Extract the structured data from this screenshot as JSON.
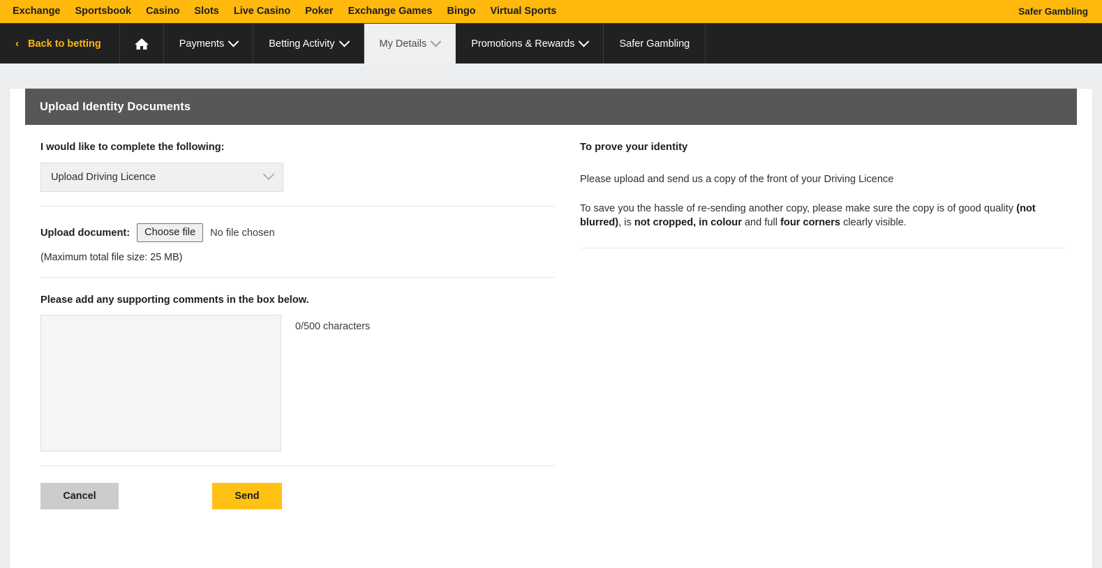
{
  "topbar": {
    "links": [
      {
        "label": "Exchange"
      },
      {
        "label": "Sportsbook"
      },
      {
        "label": "Casino"
      },
      {
        "label": "Slots"
      },
      {
        "label": "Live Casino"
      },
      {
        "label": "Poker"
      },
      {
        "label": "Exchange Games"
      },
      {
        "label": "Bingo"
      },
      {
        "label": "Virtual Sports"
      }
    ],
    "right_label": "Safer Gambling",
    "background": "#ffb80c"
  },
  "navbar": {
    "background": "#212121",
    "back_chevron": "‹",
    "back_label": "Back to betting",
    "home_icon": "home-icon",
    "items": [
      {
        "label": "Payments",
        "has_caret": true,
        "active": false
      },
      {
        "label": "Betting Activity",
        "has_caret": true,
        "active": false
      },
      {
        "label": "My Details",
        "has_caret": true,
        "active": true
      },
      {
        "label": "Promotions & Rewards",
        "has_caret": true,
        "active": false
      },
      {
        "label": "Safer Gambling",
        "has_caret": false,
        "active": false
      }
    ]
  },
  "card": {
    "header_title": "Upload Identity Documents",
    "header_background": "#575757"
  },
  "form": {
    "select_label": "I would like to complete the following:",
    "select_value": "Upload Driving Licence",
    "upload_label": "Upload document:",
    "choose_file_label": "Choose file",
    "no_file_text": "No file chosen",
    "file_size_hint": "(Maximum total file size: 25 MB)",
    "comments_label": "Please add any supporting comments in the box below.",
    "comments_value": "",
    "comments_placeholder": "",
    "char_count": "0/500 characters",
    "cancel_label": "Cancel",
    "send_label": "Send",
    "send_color": "#ffc114"
  },
  "info": {
    "title": "To prove your identity",
    "paragraph1": "Please upload and send us a copy of the front of your Driving Licence",
    "paragraph2": {
      "part1": "To save you the hassle of re-sending another copy, please make sure the copy is of good quality ",
      "bold1": "(not blurred)",
      "part2": ", is ",
      "bold2": "not cropped, in colour",
      "part3": " and full ",
      "bold3": "four corners",
      "part4": " clearly visible."
    }
  }
}
